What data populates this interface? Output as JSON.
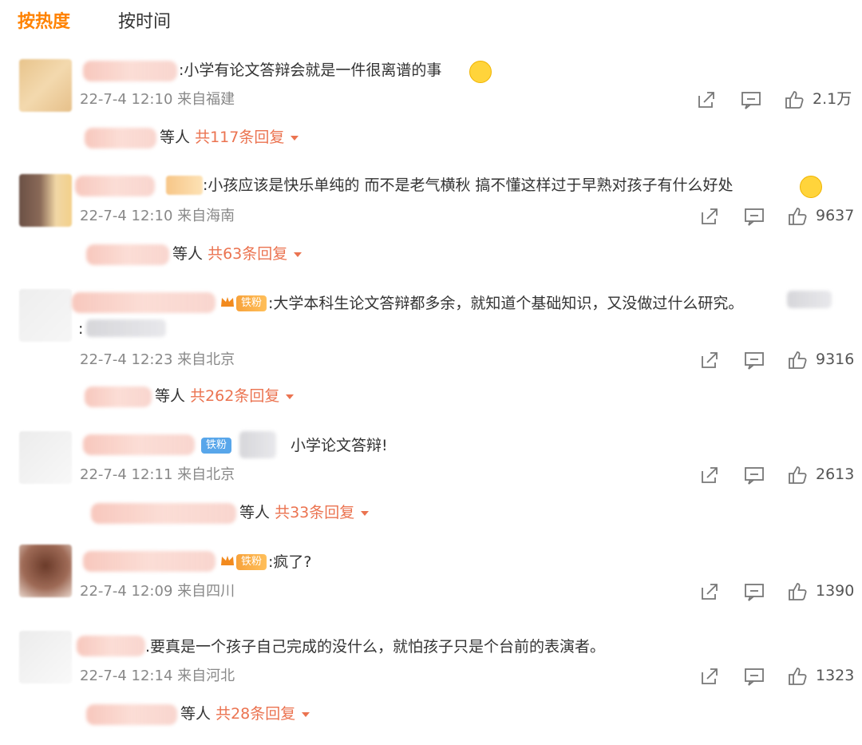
{
  "tabs": {
    "hot": "按热度",
    "time": "按时间"
  },
  "badge_label": "铁粉",
  "comments": [
    {
      "text": ":小学有论文答辩会就是一件很离谱的事",
      "meta": "22-7-4 12:10 来自福建",
      "likes": "2.1万",
      "reply_prefix": "等人",
      "reply_total": "共117条回复"
    },
    {
      "text": ":小孩应该是快乐单纯的 而不是老气横秋 搞不懂这样过于早熟对孩子有什么好处",
      "meta": "22-7-4 12:10 来自海南",
      "likes": "9637",
      "reply_prefix": "等人",
      "reply_total": "共63条回复"
    },
    {
      "text": ":大学本科生论文答辩都多余，就知道个基础知识，又没做过什么研究。",
      "text2": ":",
      "meta": "22-7-4 12:23 来自北京",
      "likes": "9316",
      "reply_prefix": "等人",
      "reply_total": "共262条回复"
    },
    {
      "text": "小学论文答辩!",
      "meta": "22-7-4 12:11 来自北京",
      "likes": "2613",
      "reply_prefix": "等人",
      "reply_total": "共33条回复"
    },
    {
      "text": ":疯了?",
      "meta": "22-7-4 12:09 来自四川",
      "likes": "1390"
    },
    {
      "text": ".要真是一个孩子自己完成的没什么，就怕孩子只是个台前的表演者。",
      "meta": "22-7-4 12:14 来自河北",
      "likes": "1323",
      "reply_prefix": "等人",
      "reply_total": "共28条回复"
    }
  ],
  "colors": {
    "accent": "#ff8200",
    "reply_link": "#eb7350",
    "meta": "#888888"
  },
  "icons": [
    "share-icon",
    "comment-icon",
    "like-icon",
    "expand-caret-icon"
  ]
}
